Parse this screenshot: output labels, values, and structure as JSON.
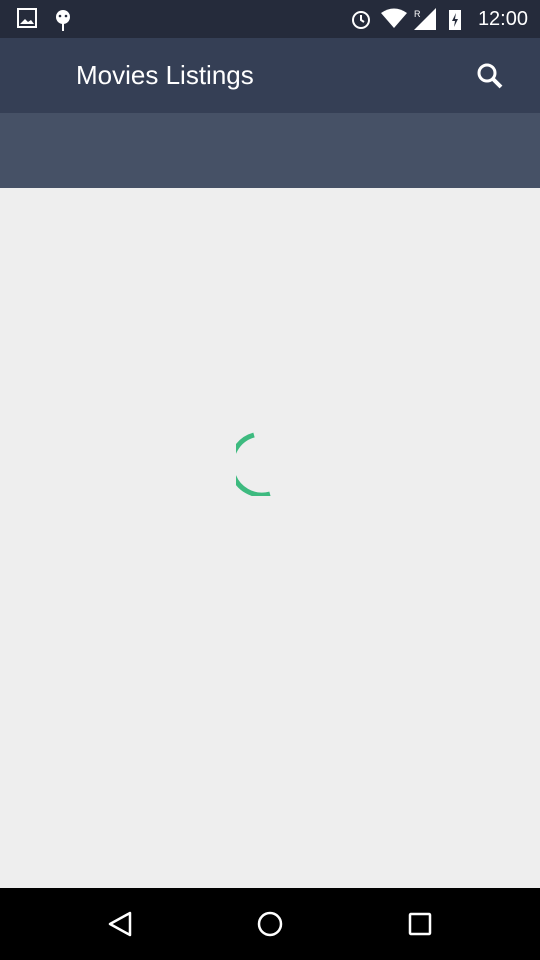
{
  "status_bar": {
    "time": "12:00",
    "icons": [
      "image-icon",
      "android-icon",
      "alarm-icon",
      "wifi-icon",
      "signal-icon",
      "battery-charging-icon"
    ]
  },
  "app_bar": {
    "title": "Movies Listings",
    "search_icon": "search-icon"
  },
  "loading": {
    "color": "#3dba7f"
  },
  "nav_bar": {
    "icons": [
      "back-icon",
      "home-icon",
      "recents-icon"
    ]
  }
}
